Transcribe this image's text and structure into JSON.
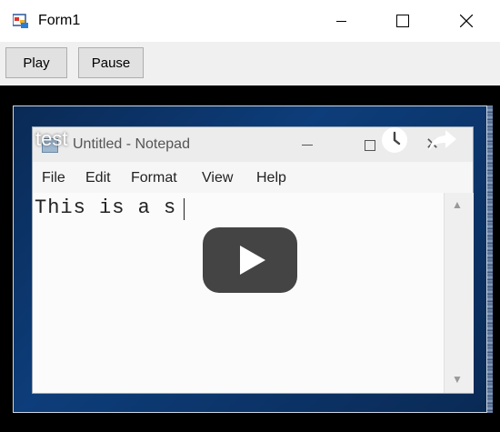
{
  "window": {
    "title": "Form1",
    "icon": "winforms-app-icon",
    "controls": {
      "minimize": "minimize-icon",
      "maximize": "maximize-icon",
      "close": "close-icon"
    }
  },
  "toolbar": {
    "play_label": "Play",
    "pause_label": "Pause"
  },
  "video": {
    "title": "test",
    "overlay_icons": [
      "clock-icon",
      "share-icon",
      "play-icon"
    ],
    "frame": {
      "app_title": "Untitled - Notepad",
      "menu": [
        "File",
        "Edit",
        "Format",
        "View",
        "Help"
      ],
      "editor_text": "This is a s"
    }
  },
  "colors": {
    "video_background": "#000000",
    "play_button": "#232323",
    "form_background": "#f0f0f0"
  }
}
